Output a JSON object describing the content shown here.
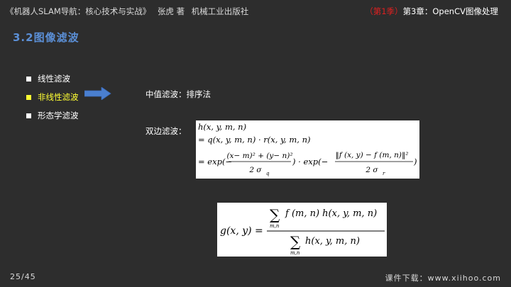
{
  "header": {
    "book_title": "《机器人SLAM导航：核心技术与实战》",
    "author": "张虎 著",
    "publisher": "机械工业出版社",
    "season": "（第1季）",
    "chapter": "第3章：OpenCV图像处理"
  },
  "section_title": "3.2图像滤波",
  "bullets": [
    {
      "label": "线性滤波"
    },
    {
      "label": "非线性滤波"
    },
    {
      "label": "形态学滤波"
    }
  ],
  "labels": {
    "median": "中值滤波：排序法",
    "bilateral": "双边滤波："
  },
  "formula1": {
    "line1": "h(x, y, m, n)",
    "line2": "= q(x, y, m, n) · r(x, y, m, n)",
    "exp": "= exp(−",
    "num1": "(x− m)² + (y− n)²",
    "den1": "2 σ",
    "sub1": "q",
    "mid": ") · exp(−",
    "num2": "‖f (x, y) − f (m, n)‖²",
    "den2": "2 σ",
    "sub2": "r",
    "close": ")"
  },
  "formula2": {
    "lhs": "g(x, y) =",
    "sum": "∑",
    "sum_sub": "m,n",
    "numerator": "f (m, n) h(x, y, m, n)",
    "denominator": "h(x, y, m, n)"
  },
  "footer": {
    "page": "25/45",
    "download": "课件下载：www.xiihoo.com"
  }
}
